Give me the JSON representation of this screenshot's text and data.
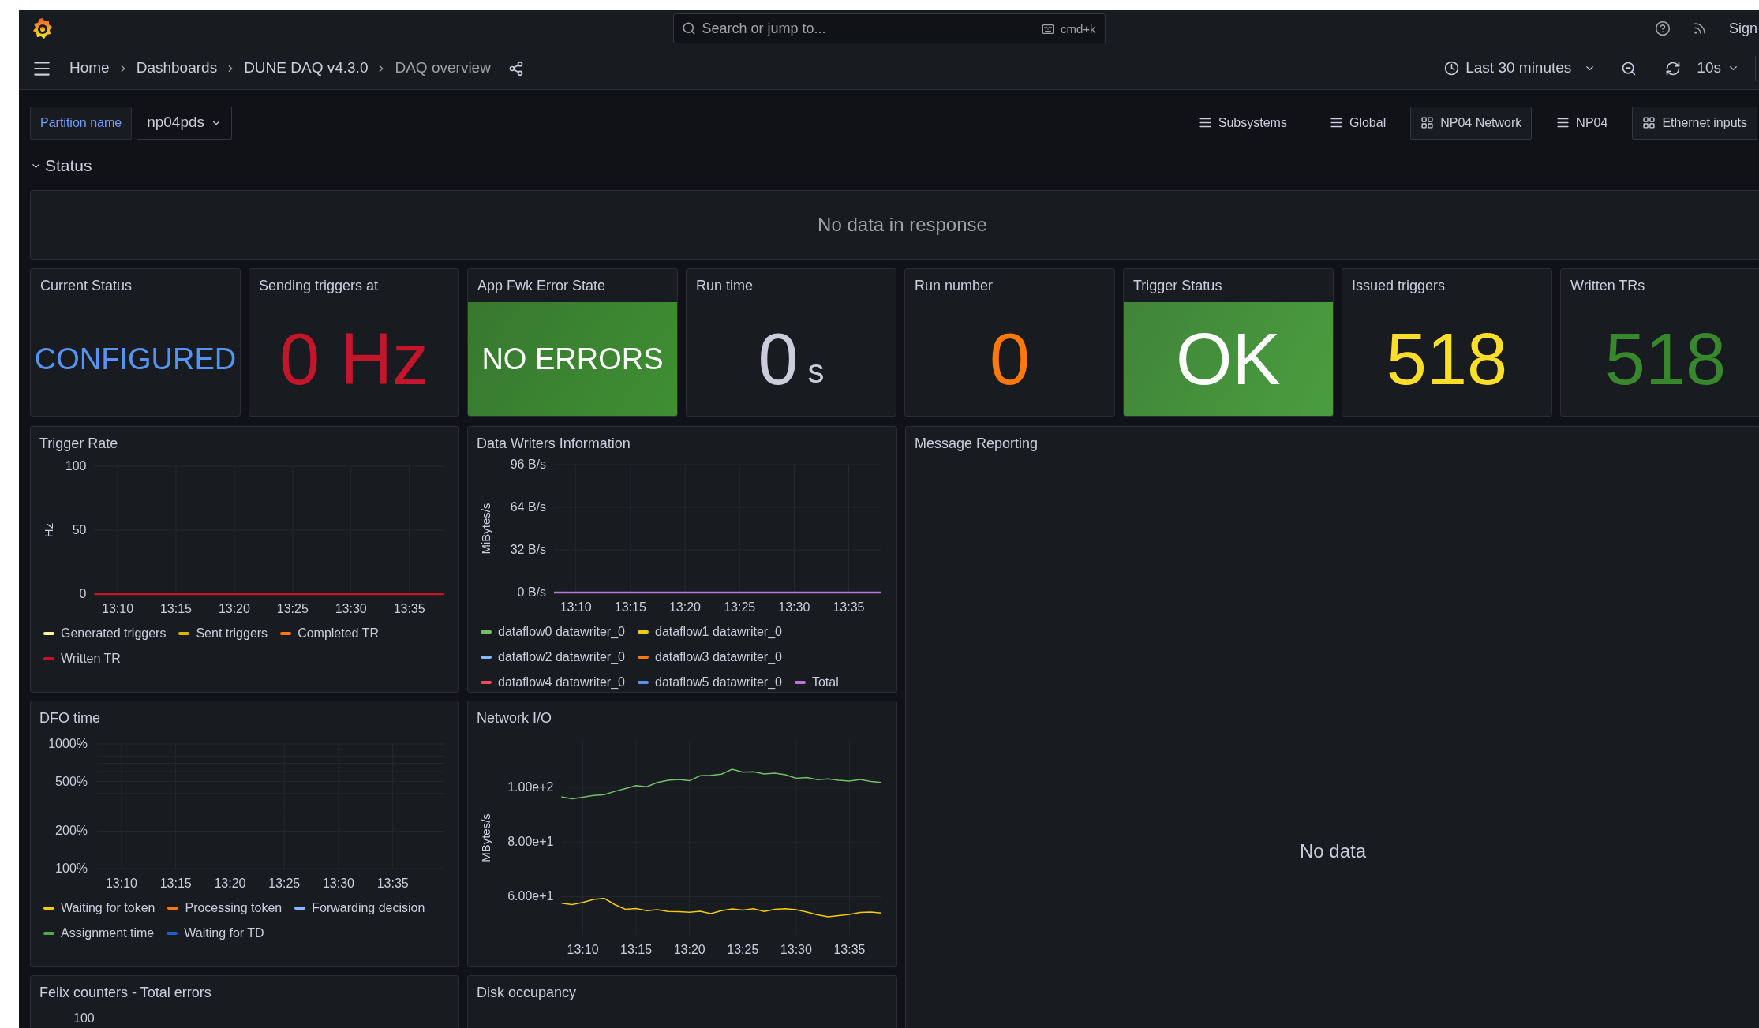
{
  "top_bar": {
    "search": {
      "placeholder": "Search or jump to...",
      "shortcut": "cmd+k"
    },
    "sign_in": "Sign"
  },
  "breadcrumbs": [
    {
      "label": "Home",
      "current": false
    },
    {
      "label": "Dashboards",
      "current": false
    },
    {
      "label": "DUNE DAQ v4.3.0",
      "current": false
    },
    {
      "label": "DAQ overview",
      "current": true
    }
  ],
  "time_picker": {
    "range": "Last 30 minutes",
    "refresh": "10s"
  },
  "variables": [
    {
      "label": "Partition name",
      "value": "np04pds"
    }
  ],
  "dashboard_links": [
    {
      "label": "Subsystems",
      "kind": "list"
    },
    {
      "label": "Global",
      "kind": "list"
    },
    {
      "label": "NP04 Network",
      "kind": "dashboard"
    },
    {
      "label": "NP04",
      "kind": "list"
    },
    {
      "label": "Ethernet inputs",
      "kind": "dashboard"
    }
  ],
  "row": {
    "title": "Status",
    "expanded": true
  },
  "notice_panel": {
    "message": "No data in response"
  },
  "stat_panels": [
    {
      "title": "Current Status",
      "value": "CONFIGURED",
      "kind": "text",
      "color": "#5794f2"
    },
    {
      "title": "Sending triggers at",
      "value": "0 Hz",
      "kind": "text",
      "color": "#c4162a"
    },
    {
      "title": "App Fwk Error State",
      "value": "NO ERRORS",
      "kind": "background",
      "color": "#3f8f33"
    },
    {
      "title": "Run time",
      "value": "0",
      "unit": "s",
      "kind": "text",
      "color": "#ccccdc"
    },
    {
      "title": "Run number",
      "value": "0",
      "kind": "text",
      "color": "#ff780a"
    },
    {
      "title": "Trigger Status",
      "value": "OK",
      "kind": "background",
      "color": "#4a9e3f"
    },
    {
      "title": "Issued triggers",
      "value": "518",
      "kind": "text",
      "color": "#fade2a"
    },
    {
      "title": "Written TRs",
      "value": "518",
      "kind": "text",
      "color": "#37872d"
    }
  ],
  "chart_panels": [
    {
      "title": "Trigger Rate",
      "kind": "chart",
      "chart_data": {
        "type": "line",
        "ylabel": "Hz",
        "ylim": [
          0,
          100
        ],
        "grid": true,
        "legend": true,
        "categories": [
          null,
          null,
          "13:10",
          null,
          null,
          null,
          null,
          "13:15",
          null,
          null,
          null,
          null,
          "13:20",
          null,
          null,
          null,
          null,
          "13:25",
          null,
          null,
          null,
          null,
          "13:30",
          null,
          null,
          null,
          null,
          "13:35",
          null,
          null,
          null
        ],
        "yticks": [
          {
            "value": 0,
            "label": "0"
          },
          {
            "value": 50,
            "label": "50"
          },
          {
            "value": 100,
            "label": "100"
          }
        ],
        "series": [
          {
            "name": "Generated triggers",
            "color": "#fff899",
            "values": [
              null,
              null,
              null,
              null,
              null,
              null,
              null,
              null,
              null,
              null,
              null,
              null,
              null,
              null,
              null,
              null,
              null,
              null,
              null,
              null,
              null,
              null,
              null,
              null,
              null,
              null,
              null,
              null,
              null,
              null,
              null
            ]
          },
          {
            "name": "Sent triggers",
            "color": "#e0b400",
            "values": [
              null,
              null,
              null,
              null,
              null,
              null,
              null,
              null,
              null,
              null,
              null,
              null,
              null,
              null,
              null,
              null,
              null,
              null,
              null,
              null,
              null,
              null,
              null,
              null,
              null,
              null,
              null,
              null,
              null,
              null,
              null
            ]
          },
          {
            "name": "Completed TR",
            "color": "#ff780a",
            "values": [
              null,
              null,
              null,
              null,
              null,
              null,
              null,
              null,
              null,
              null,
              null,
              null,
              null,
              null,
              null,
              null,
              null,
              null,
              null,
              null,
              null,
              null,
              null,
              null,
              null,
              null,
              null,
              null,
              null,
              null,
              null
            ]
          },
          {
            "name": "Written TR",
            "color": "#c4162a",
            "values": [
              0,
              0,
              0,
              0,
              0,
              0,
              0,
              0,
              0,
              0,
              0,
              0,
              0,
              0,
              0,
              0,
              0,
              0,
              0,
              0,
              0,
              0,
              0,
              0,
              0,
              0,
              0,
              0,
              0,
              0,
              0
            ]
          }
        ]
      }
    },
    {
      "title": "Data Writers Information",
      "kind": "chart",
      "chart_data": {
        "type": "line",
        "ylabel": "MiBytes/s",
        "ylim": [
          0,
          96
        ],
        "grid": true,
        "legend": true,
        "categories": [
          null,
          null,
          "13:10",
          null,
          null,
          null,
          null,
          "13:15",
          null,
          null,
          null,
          null,
          "13:20",
          null,
          null,
          null,
          null,
          "13:25",
          null,
          null,
          null,
          null,
          "13:30",
          null,
          null,
          null,
          null,
          "13:35",
          null,
          null,
          null
        ],
        "yticks": [
          {
            "value": 0,
            "label": "0 B/s"
          },
          {
            "value": 32,
            "label": "32 B/s"
          },
          {
            "value": 64,
            "label": "64 B/s"
          },
          {
            "value": 96,
            "label": "96 B/s"
          }
        ],
        "series": [
          {
            "name": "dataflow0 datawriter_0",
            "color": "#73bf69",
            "values": [
              null,
              null,
              null,
              null,
              null,
              null,
              null,
              null,
              null,
              null,
              null,
              null,
              null,
              null,
              null,
              null,
              null,
              null,
              null,
              null,
              null,
              null,
              null,
              null,
              null,
              null,
              null,
              null,
              null,
              null,
              null
            ]
          },
          {
            "name": "dataflow1 datawriter_0",
            "color": "#f2cc0c",
            "values": [
              null,
              null,
              null,
              null,
              null,
              null,
              null,
              null,
              null,
              null,
              null,
              null,
              null,
              null,
              null,
              null,
              null,
              null,
              null,
              null,
              null,
              null,
              null,
              null,
              null,
              null,
              null,
              null,
              null,
              null,
              null
            ]
          },
          {
            "name": "dataflow2 datawriter_0",
            "color": "#8ab8ff",
            "values": [
              null,
              null,
              null,
              null,
              null,
              null,
              null,
              null,
              null,
              null,
              null,
              null,
              null,
              null,
              null,
              null,
              null,
              null,
              null,
              null,
              null,
              null,
              null,
              null,
              null,
              null,
              null,
              null,
              null,
              null,
              null
            ]
          },
          {
            "name": "dataflow3 datawriter_0",
            "color": "#ff780a",
            "values": [
              null,
              null,
              null,
              null,
              null,
              null,
              null,
              null,
              null,
              null,
              null,
              null,
              null,
              null,
              null,
              null,
              null,
              null,
              null,
              null,
              null,
              null,
              null,
              null,
              null,
              null,
              null,
              null,
              null,
              null,
              null
            ]
          },
          {
            "name": "dataflow4 datawriter_0",
            "color": "#f2495c",
            "values": [
              null,
              null,
              null,
              null,
              null,
              null,
              null,
              null,
              null,
              null,
              null,
              null,
              null,
              null,
              null,
              null,
              null,
              null,
              null,
              null,
              null,
              null,
              null,
              null,
              null,
              null,
              null,
              null,
              null,
              null,
              null
            ]
          },
          {
            "name": "dataflow5 datawriter_0",
            "color": "#5794f2",
            "values": [
              null,
              null,
              null,
              null,
              null,
              null,
              null,
              null,
              null,
              null,
              null,
              null,
              null,
              null,
              null,
              null,
              null,
              null,
              null,
              null,
              null,
              null,
              null,
              null,
              null,
              null,
              null,
              null,
              null,
              null,
              null
            ]
          },
          {
            "name": "Total",
            "color": "#b877d9",
            "values": [
              0,
              0,
              0,
              0,
              0,
              0,
              0,
              0,
              0,
              0,
              0,
              0,
              0,
              0,
              0,
              0,
              0,
              0,
              0,
              0,
              0,
              0,
              0,
              0,
              0,
              0,
              0,
              0,
              0,
              0,
              0
            ]
          }
        ]
      }
    },
    {
      "title": "DFO time",
      "kind": "empty_chart",
      "y_ticks": [
        "1000%",
        "500%",
        "200%",
        "100%"
      ],
      "x_ticks": [
        "13:10",
        "13:15",
        "13:20",
        "13:25",
        "13:30",
        "13:35"
      ],
      "legend": [
        {
          "name": "Waiting for token",
          "color": "#f2cc0c"
        },
        {
          "name": "Processing token",
          "color": "#ff780a"
        },
        {
          "name": "Forwarding decision",
          "color": "#8ab8ff"
        },
        {
          "name": "Assignment time",
          "color": "#56a64b"
        },
        {
          "name": "Waiting for TD",
          "color": "#1f60c4"
        }
      ]
    },
    {
      "title": "Network I/O",
      "kind": "chart",
      "chart_data": {
        "type": "line",
        "ylabel": "MBytes/s",
        "ylim": [
          46,
          117
        ],
        "grid": true,
        "categories": [
          null,
          null,
          "13:10",
          null,
          null,
          null,
          null,
          "13:15",
          null,
          null,
          null,
          null,
          "13:20",
          null,
          null,
          null,
          null,
          "13:25",
          null,
          null,
          null,
          null,
          "13:30",
          null,
          null,
          null,
          null,
          "13:35",
          null,
          null,
          null
        ],
        "yticks": [
          {
            "value": 60,
            "label": "6.00e+1"
          },
          {
            "value": 80,
            "label": "8.00e+1"
          },
          {
            "value": 100,
            "label": "1.00e+2"
          }
        ],
        "series": [
          {
            "color": "#73bf69",
            "values": [
              96.5,
              95.8,
              96.4,
              97,
              97.3,
              98.5,
              99.5,
              100.6,
              100.2,
              101.8,
              102.6,
              102.9,
              102.4,
              104.2,
              104.4,
              104.8,
              106.6,
              105.5,
              105.7,
              104.9,
              105.2,
              104.6,
              103.3,
              103.6,
              102.8,
              103.1,
              102.6,
              102.3,
              102.9,
              102.1,
              101.8
            ]
          },
          {
            "color": "#f2cc0c",
            "values": [
              57.6,
              57.1,
              57.9,
              59,
              59.4,
              57.1,
              55.4,
              55.7,
              54.9,
              55.2,
              54.6,
              54.5,
              54.3,
              54.7,
              53.8,
              54.9,
              55.5,
              55.1,
              55.6,
              54.6,
              55.4,
              55.6,
              55.2,
              54.4,
              53.4,
              52.6,
              53.1,
              53.5,
              54.2,
              54.4,
              54
            ]
          }
        ]
      }
    }
  ],
  "message_panel": {
    "title": "Message Reporting",
    "message": "No data"
  },
  "bottom_panels": [
    {
      "title": "Felix counters - Total errors",
      "tick": "100"
    },
    {
      "title": "Disk occupancy"
    }
  ]
}
